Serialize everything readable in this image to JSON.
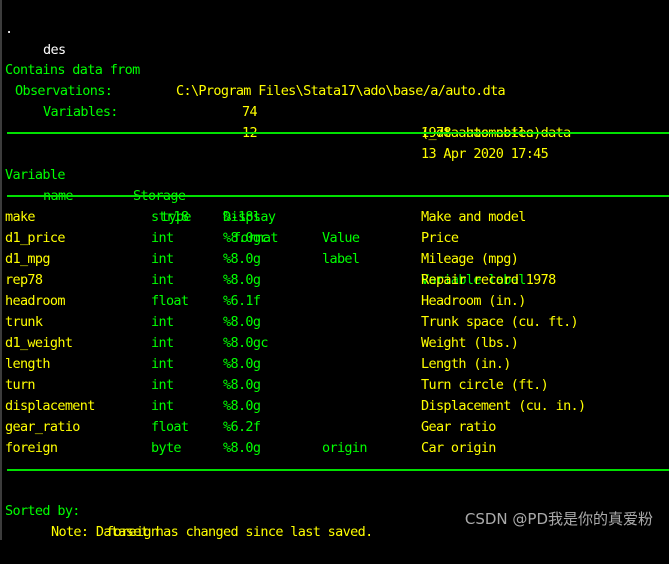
{
  "command": {
    "prompt": ".",
    "text": "des"
  },
  "header": {
    "contains_label": "Contains data from",
    "file_path": "C:\\Program Files\\Stata17\\ado\\base/a/auto.dta",
    "observations_label": "Observations:",
    "observations_value": "74",
    "variables_label": "Variables:",
    "variables_value": "12",
    "dataset_label": "1978 automobile data",
    "timestamp": "13 Apr 2020 17:45",
    "notes": "(_dta has notes)"
  },
  "columns": {
    "variable_top": "Variable",
    "variable_bottom": "name",
    "storage_top": "Storage",
    "storage_bottom": "type",
    "display_top": "Display",
    "display_bottom": "format",
    "value_top": "Value",
    "value_bottom": "label",
    "varlabel": "Variable label"
  },
  "rows": [
    {
      "name": "make",
      "type": "str18",
      "format": "%-18s",
      "value_label": "",
      "label": "Make and model"
    },
    {
      "name": "d1_price",
      "type": "int",
      "format": "%8.0gc",
      "value_label": "",
      "label": "Price"
    },
    {
      "name": "d1_mpg",
      "type": "int",
      "format": "%8.0g",
      "value_label": "",
      "label": "Mileage (mpg)"
    },
    {
      "name": "rep78",
      "type": "int",
      "format": "%8.0g",
      "value_label": "",
      "label": "Repair record 1978"
    },
    {
      "name": "headroom",
      "type": "float",
      "format": "%6.1f",
      "value_label": "",
      "label": "Headroom (in.)"
    },
    {
      "name": "trunk",
      "type": "int",
      "format": "%8.0g",
      "value_label": "",
      "label": "Trunk space (cu. ft.)"
    },
    {
      "name": "d1_weight",
      "type": "int",
      "format": "%8.0gc",
      "value_label": "",
      "label": "Weight (lbs.)"
    },
    {
      "name": "length",
      "type": "int",
      "format": "%8.0g",
      "value_label": "",
      "label": "Length (in.)"
    },
    {
      "name": "turn",
      "type": "int",
      "format": "%8.0g",
      "value_label": "",
      "label": "Turn circle (ft.)"
    },
    {
      "name": "displacement",
      "type": "int",
      "format": "%8.0g",
      "value_label": "",
      "label": "Displacement (cu. in.)"
    },
    {
      "name": "gear_ratio",
      "type": "float",
      "format": "%6.2f",
      "value_label": "",
      "label": "Gear ratio"
    },
    {
      "name": "foreign",
      "type": "byte",
      "format": "%8.0g",
      "value_label": "origin",
      "label": "Car origin"
    }
  ],
  "footer": {
    "sorted_label": "Sorted by:",
    "sorted_value": "foreign",
    "note": "Note: Dataset has changed since last saved."
  },
  "watermark": "CSDN @PD我是你的真爱粉",
  "colors": {
    "background": "#000000",
    "result_green": "#00ff00",
    "text_yellow": "#ffff00",
    "command_white": "#ffffff"
  }
}
